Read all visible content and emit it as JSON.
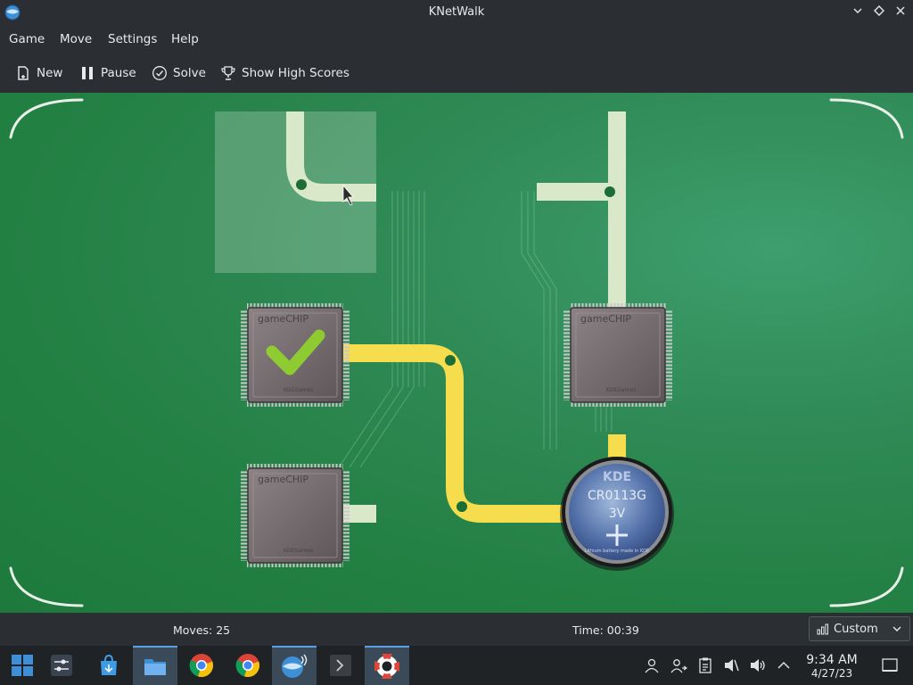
{
  "window": {
    "title": "KNetWalk"
  },
  "menu": {
    "items": [
      "Game",
      "Move",
      "Settings",
      "Help"
    ]
  },
  "toolbar": {
    "new_label": "New",
    "pause_label": "Pause",
    "solve_label": "Solve",
    "highscores_label": "Show High Scores"
  },
  "board": {
    "chip_label": "gameCHIP",
    "chip_maker": "KDEGames",
    "battery_brand": "KDE",
    "battery_model": "CR0113G",
    "battery_voltage": "3V",
    "battery_tagline": "Lithium battery made in KDE",
    "colors": {
      "connected": "#f5dd4e",
      "disconnected": "#d9e8c9",
      "board": "#2a8a4e",
      "highlight": "#8fd12e"
    }
  },
  "status": {
    "moves": "Moves: 25",
    "time": "Time: 00:39",
    "difficulty": "Custom"
  },
  "taskbar": {
    "apps": [
      "start-menu-icon",
      "settings-sliders-icon",
      "store-icon",
      "file-manager-icon",
      "chrome-icon",
      "chrome-icon",
      "knetwalk-icon",
      "terminal-icon",
      "lifebuoy-icon"
    ],
    "clock_time": "9:34 AM",
    "clock_date": "4/27/23"
  }
}
